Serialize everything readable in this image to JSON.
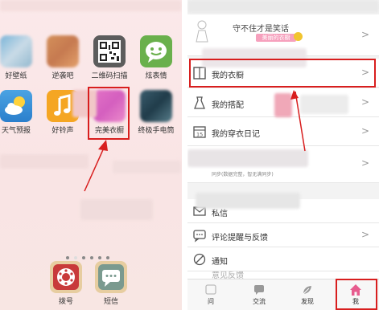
{
  "left_screen": {
    "apps_row1": [
      {
        "label": "好壁纸"
      },
      {
        "label": "逆袭吧"
      },
      {
        "label": "二维码扫描"
      },
      {
        "label": "炫表情"
      }
    ],
    "apps_row2": [
      {
        "label": "天气预报"
      },
      {
        "label": "好铃声"
      },
      {
        "label": "完美衣橱"
      },
      {
        "label": "终极手电筒"
      }
    ],
    "dock": [
      {
        "label": "拨号"
      },
      {
        "label": "短信"
      }
    ],
    "page_dots": 6
  },
  "right_screen": {
    "profile": {
      "motto": "守不住才是笑话",
      "badge": "美丽的衣橱"
    },
    "menu": [
      {
        "label": "我的衣橱",
        "icon": "wardrobe-icon"
      },
      {
        "label": "我的搭配",
        "icon": "dress-icon"
      },
      {
        "label": "我的穿衣日记",
        "icon": "calendar-icon"
      }
    ],
    "sync_label": "同步(数据完整，智无满同步)",
    "menu2": [
      {
        "label": "私信",
        "icon": "mail-icon"
      },
      {
        "label": "评论提醒与反馈",
        "icon": "comment-icon"
      },
      {
        "label": "通知",
        "icon": "bell-off-icon"
      },
      {
        "label": "意见反馈",
        "icon": "feedback-icon"
      }
    ],
    "tabs": [
      {
        "label": "问",
        "icon": "ask-icon"
      },
      {
        "label": "交流",
        "icon": "chat-icon"
      },
      {
        "label": "发现",
        "icon": "leaf-icon"
      },
      {
        "label": "我",
        "icon": "home-icon"
      }
    ]
  },
  "colors": {
    "highlight": "#d81e1e",
    "accent_pink": "#e75b8e",
    "badge_yellow": "#f1c42f"
  }
}
